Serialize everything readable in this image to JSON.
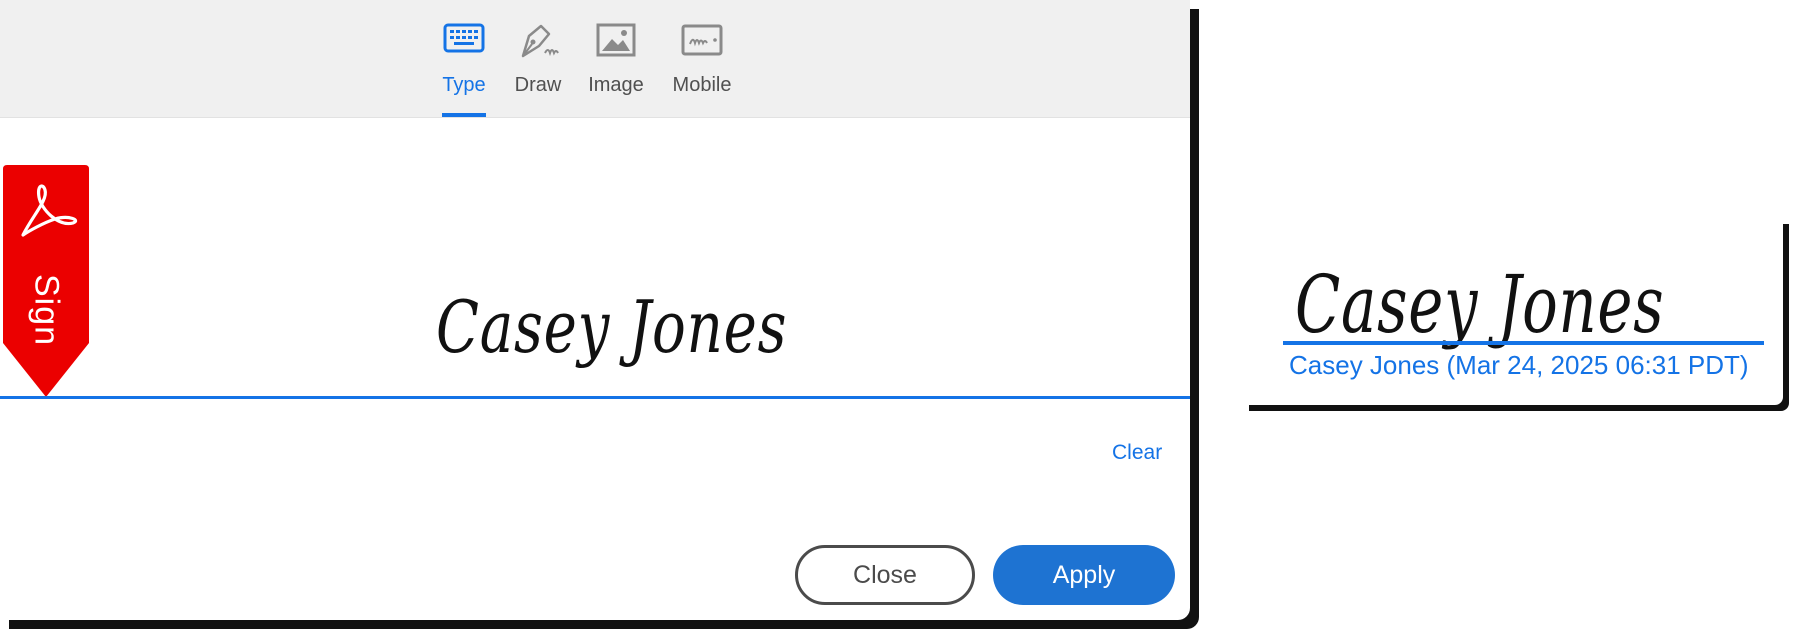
{
  "dialog": {
    "tabs": [
      {
        "label": "Type",
        "icon": "keyboard-icon",
        "active": true
      },
      {
        "label": "Draw",
        "icon": "pen-icon",
        "active": false
      },
      {
        "label": "Image",
        "icon": "image-icon",
        "active": false
      },
      {
        "label": "Mobile",
        "icon": "mobile-icon",
        "active": false
      }
    ],
    "bookmark_label": "Sign",
    "signature_text": "Casey Jones",
    "clear_label": "Clear",
    "close_label": "Close",
    "apply_label": "Apply"
  },
  "preview": {
    "signature_text": "Casey Jones",
    "caption": "Casey Jones (Mar 24, 2025 06:31 PDT)"
  },
  "colors": {
    "accent": "#1473e6",
    "apply_button": "#1e73d2",
    "bookmark_red": "#eb0000",
    "tabbar_bg": "#f0f0f0"
  }
}
